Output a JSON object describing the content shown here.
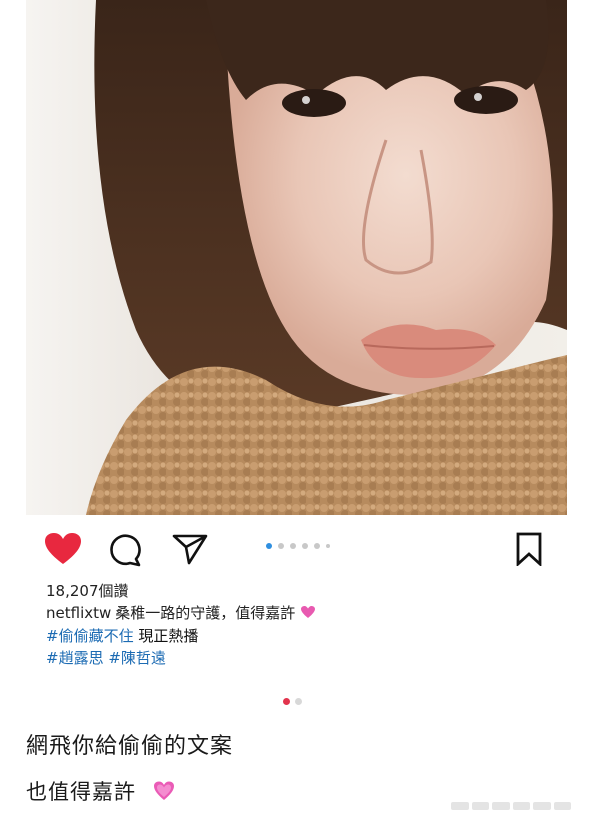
{
  "post": {
    "likes": "18,207個讚",
    "username": "netflixtw",
    "caption": "桑稚一路的守護，值得嘉許",
    "tags_line1": "#偷偷藏不住",
    "tags_line1_extra": " 現正熱播",
    "tags_line2a": "#趙露思",
    "tags_line2b": "#陳哲遠"
  },
  "footer": {
    "headline": "網飛你給偷偷的文案",
    "subline": "也值得嘉許"
  },
  "icons": {
    "like": "heart-icon",
    "comment": "comment-icon",
    "share": "send-icon",
    "save": "bookmark-icon",
    "caption_emoji": "sparkling-heart-icon"
  },
  "colors": {
    "like_active": "#e8283f",
    "carousel_active": "#2f8fe0",
    "hashtag": "#1c6bb3",
    "pager_active": "#e2344d"
  }
}
